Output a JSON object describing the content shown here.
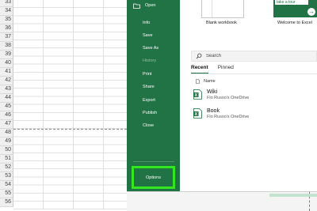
{
  "sheet": {
    "row_numbers": [
      "33",
      "34",
      "35",
      "36",
      "37",
      "38",
      "39",
      "40",
      "41",
      "42",
      "43",
      "44",
      "45",
      "46",
      "47",
      "48",
      "49",
      "50",
      "51",
      "52",
      "53",
      "54",
      "55",
      "56"
    ]
  },
  "backstage": {
    "open_label": "Open",
    "items": [
      {
        "label": "Info",
        "disabled": false
      },
      {
        "label": "Save",
        "disabled": false
      },
      {
        "label": "Save As",
        "disabled": false
      },
      {
        "label": "History",
        "disabled": true
      },
      {
        "label": "Print",
        "disabled": false
      },
      {
        "label": "Share",
        "disabled": false
      },
      {
        "label": "Export",
        "disabled": false
      },
      {
        "label": "Publish",
        "disabled": false
      },
      {
        "label": "Close",
        "disabled": false
      }
    ],
    "options_label": "Options",
    "accent_color": "#217346",
    "highlight_color": "#33e61f"
  },
  "templates": {
    "blank_caption": "Blank workbook",
    "welcome_caption": "Welcome to Excel",
    "welcome_chip": "take a tour"
  },
  "search": {
    "placeholder": "Search"
  },
  "tabs": [
    {
      "label": "Recent",
      "active": true
    },
    {
      "label": "Pinned",
      "active": false
    }
  ],
  "list": {
    "name_header": "Name",
    "files": [
      {
        "title": "Wiki",
        "location": "Flo Russo's OneDrive",
        "icon": "excel-file-icon"
      },
      {
        "title": "Book",
        "location": "Flo Russo's OneDrive",
        "icon": "excel-file-icon"
      }
    ]
  }
}
